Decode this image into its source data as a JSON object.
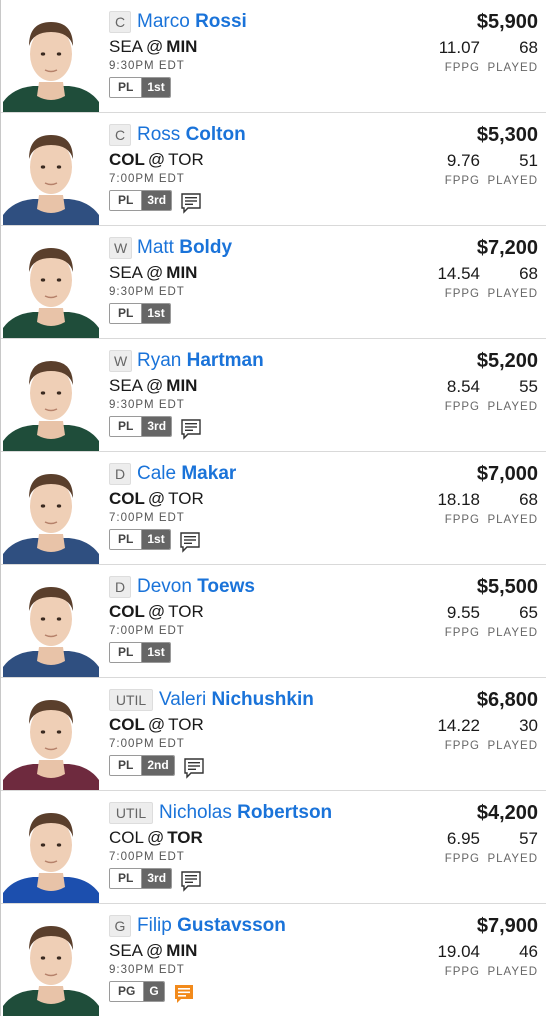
{
  "colors": {
    "name_link": "#1a73d9",
    "badge_line_bg": "#666666",
    "note_icon_highlight": "#f28a1b"
  },
  "labels": {
    "fppg": "FPPG",
    "played": "PLAYED",
    "at": "@"
  },
  "players": [
    {
      "position": "C",
      "first_name": "Marco",
      "last_name": "Rossi",
      "away": "SEA",
      "home": "MIN",
      "bold_team": "home",
      "time": "9:30PM EDT",
      "slot": "PL",
      "line": "1st",
      "note": "none",
      "salary": "$5,900",
      "fppg": "11.07",
      "played": "68",
      "jersey": "#1f4d3a"
    },
    {
      "position": "C",
      "first_name": "Ross",
      "last_name": "Colton",
      "away": "COL",
      "home": "TOR",
      "bold_team": "away",
      "time": "7:00PM EDT",
      "slot": "PL",
      "line": "3rd",
      "note": "news-icon",
      "salary": "$5,300",
      "fppg": "9.76",
      "played": "51",
      "jersey": "#2f4f80"
    },
    {
      "position": "W",
      "first_name": "Matt",
      "last_name": "Boldy",
      "away": "SEA",
      "home": "MIN",
      "bold_team": "home",
      "time": "9:30PM EDT",
      "slot": "PL",
      "line": "1st",
      "note": "none",
      "salary": "$7,200",
      "fppg": "14.54",
      "played": "68",
      "jersey": "#1f4d3a"
    },
    {
      "position": "W",
      "first_name": "Ryan",
      "last_name": "Hartman",
      "away": "SEA",
      "home": "MIN",
      "bold_team": "home",
      "time": "9:30PM EDT",
      "slot": "PL",
      "line": "3rd",
      "note": "news-icon",
      "salary": "$5,200",
      "fppg": "8.54",
      "played": "55",
      "jersey": "#1f4d3a"
    },
    {
      "position": "D",
      "first_name": "Cale",
      "last_name": "Makar",
      "away": "COL",
      "home": "TOR",
      "bold_team": "away",
      "time": "7:00PM EDT",
      "slot": "PL",
      "line": "1st",
      "note": "news-icon",
      "salary": "$7,000",
      "fppg": "18.18",
      "played": "68",
      "jersey": "#2f4f80"
    },
    {
      "position": "D",
      "first_name": "Devon",
      "last_name": "Toews",
      "away": "COL",
      "home": "TOR",
      "bold_team": "away",
      "time": "7:00PM EDT",
      "slot": "PL",
      "line": "1st",
      "note": "none",
      "salary": "$5,500",
      "fppg": "9.55",
      "played": "65",
      "jersey": "#2f4f80"
    },
    {
      "position": "UTIL",
      "first_name": "Valeri",
      "last_name": "Nichushkin",
      "away": "COL",
      "home": "TOR",
      "bold_team": "away",
      "time": "7:00PM EDT",
      "slot": "PL",
      "line": "2nd",
      "note": "news-icon",
      "salary": "$6,800",
      "fppg": "14.22",
      "played": "30",
      "jersey": "#6e2a3e"
    },
    {
      "position": "UTIL",
      "first_name": "Nicholas",
      "last_name": "Robertson",
      "away": "COL",
      "home": "TOR",
      "bold_team": "home",
      "time": "7:00PM EDT",
      "slot": "PL",
      "line": "3rd",
      "note": "news-icon",
      "salary": "$4,200",
      "fppg": "6.95",
      "played": "57",
      "jersey": "#1c4fae"
    },
    {
      "position": "G",
      "first_name": "Filip",
      "last_name": "Gustavsson",
      "away": "SEA",
      "home": "MIN",
      "bold_team": "home",
      "time": "9:30PM EDT",
      "slot": "PG",
      "line": "G",
      "note": "news-icon-highlight",
      "salary": "$7,900",
      "fppg": "19.04",
      "played": "46",
      "jersey": "#1f4d3a"
    }
  ]
}
